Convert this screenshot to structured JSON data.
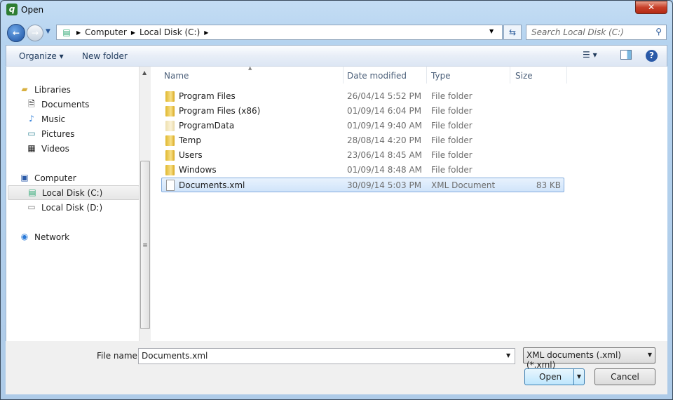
{
  "window": {
    "title": "Open",
    "close": "✕"
  },
  "address": {
    "crumbs": [
      "Computer",
      "Local Disk (C:)"
    ],
    "search_placeholder": "Search Local Disk (C:)"
  },
  "toolbar": {
    "organize": "Organize ▾",
    "new_folder": "New folder"
  },
  "nav": {
    "libraries": "Libraries",
    "lib_items": [
      "Documents",
      "Music",
      "Pictures",
      "Videos"
    ],
    "computer": "Computer",
    "drives": [
      "Local Disk (C:)",
      "Local Disk (D:)"
    ],
    "network": "Network"
  },
  "list": {
    "columns": [
      "Name",
      "Date modified",
      "Type",
      "Size"
    ],
    "rows": [
      {
        "name": "Program Files",
        "date": "26/04/14 5:52 PM",
        "type": "File folder",
        "size": ""
      },
      {
        "name": "Program Files (x86)",
        "date": "01/09/14 6:04 PM",
        "type": "File folder",
        "size": ""
      },
      {
        "name": "ProgramData",
        "date": "01/09/14 9:40 AM",
        "type": "File folder",
        "size": ""
      },
      {
        "name": "Temp",
        "date": "28/08/14 4:20 PM",
        "type": "File folder",
        "size": ""
      },
      {
        "name": "Users",
        "date": "23/06/14 8:45 AM",
        "type": "File folder",
        "size": ""
      },
      {
        "name": "Windows",
        "date": "01/09/14 8:48 AM",
        "type": "File folder",
        "size": ""
      },
      {
        "name": "Documents.xml",
        "date": "30/09/14 5:03 PM",
        "type": "XML Document",
        "size": "83 KB"
      }
    ]
  },
  "footer": {
    "file_name_label": "File name:",
    "file_name_value": "Documents.xml",
    "filter": "XML documents (.xml) (*.xml)",
    "open": "Open",
    "cancel": "Cancel"
  }
}
